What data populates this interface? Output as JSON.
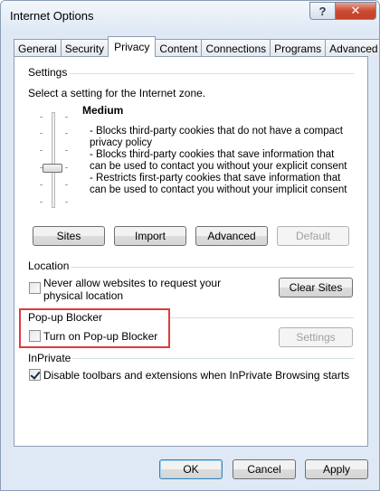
{
  "window": {
    "title": "Internet Options",
    "help_glyph": "?",
    "close_glyph": "✕"
  },
  "tabs": [
    {
      "label": "General",
      "active": false
    },
    {
      "label": "Security",
      "active": false
    },
    {
      "label": "Privacy",
      "active": true
    },
    {
      "label": "Content",
      "active": false
    },
    {
      "label": "Connections",
      "active": false
    },
    {
      "label": "Programs",
      "active": false
    },
    {
      "label": "Advanced",
      "active": false
    }
  ],
  "settings": {
    "header": "Settings",
    "instruction": "Select a setting for the Internet zone.",
    "level": "Medium",
    "descriptions": [
      "- Blocks third-party cookies that do not have a compact privacy policy",
      "- Blocks third-party cookies that save information that can be used to contact you without your explicit consent",
      "- Restricts first-party cookies that save information that can be used to contact you without your implicit consent"
    ],
    "buttons": {
      "sites": "Sites",
      "import": "Import",
      "advanced": "Advanced",
      "default": "Default"
    }
  },
  "location": {
    "header": "Location",
    "checkbox_label_line1": "Never allow websites to request your",
    "checkbox_label_line2": "physical location",
    "checked": false,
    "clear_sites": "Clear Sites"
  },
  "popup": {
    "header": "Pop-up Blocker",
    "checkbox_label": "Turn on Pop-up Blocker",
    "checked": false,
    "settings_button": "Settings"
  },
  "inprivate": {
    "header": "InPrivate",
    "checkbox_label": "Disable toolbars and extensions when InPrivate Browsing starts",
    "checked": true
  },
  "dialog_buttons": {
    "ok": "OK",
    "cancel": "Cancel",
    "apply": "Apply"
  },
  "colors": {
    "highlight": "#e03b3b",
    "close_button": "#c94a32"
  }
}
